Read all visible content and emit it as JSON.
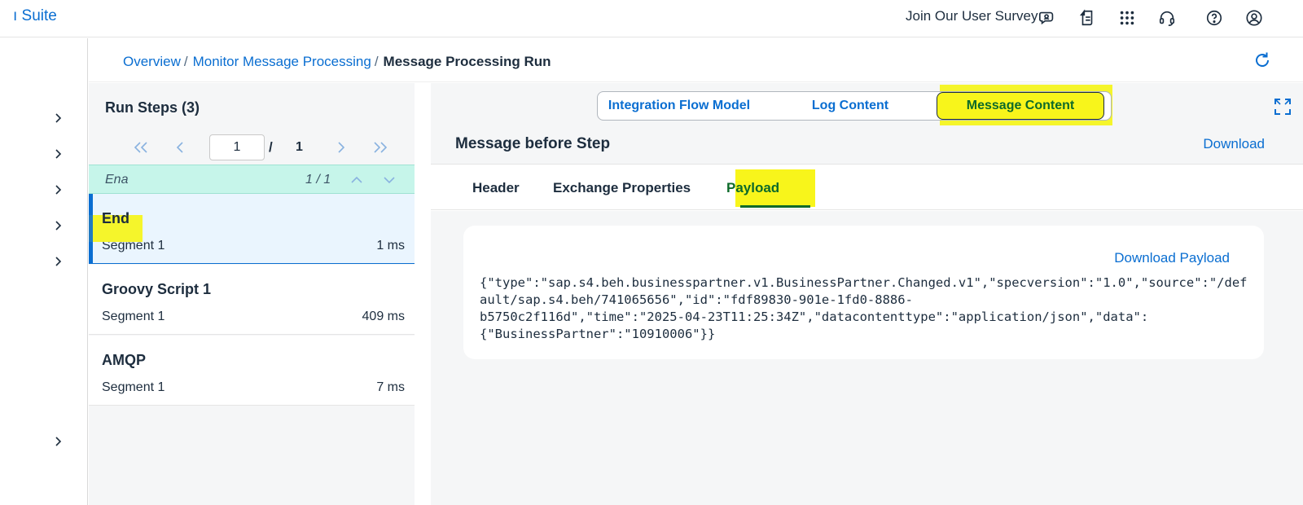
{
  "shell": {
    "title": "ı Suite",
    "survey": "Join Our User Survey",
    "icons": [
      "feedback-icon",
      "notes-icon",
      "apps-grid-icon",
      "headset-icon",
      "help-icon",
      "user-icon"
    ]
  },
  "breadcrumb": {
    "items": [
      "Overview",
      "Monitor Message Processing"
    ],
    "separator": "/",
    "current": "Message Processing Run"
  },
  "run_steps": {
    "title": "Run Steps (3)",
    "pager": {
      "current": "1",
      "slash": "/",
      "total": "1"
    },
    "search": {
      "term": "Ena",
      "count": "1 / 1"
    },
    "steps": [
      {
        "name": "End",
        "segment": "Segment 1",
        "duration": "1 ms",
        "selected": true
      },
      {
        "name": "Groovy Script 1",
        "segment": "Segment 1",
        "duration": "409 ms",
        "selected": false
      },
      {
        "name": "AMQP",
        "segment": "Segment 1",
        "duration": "7 ms",
        "selected": false
      }
    ]
  },
  "view_switch": {
    "options": [
      "Integration Flow Model",
      "Log Content",
      "Message Content"
    ],
    "selected": "Message Content"
  },
  "message": {
    "title": "Message before Step",
    "download": "Download",
    "tabs": [
      "Header",
      "Exchange Properties",
      "Payload"
    ],
    "active_tab": "Payload",
    "download_payload": "Download Payload",
    "payload": "{\"type\":\"sap.s4.beh.businesspartner.v1.BusinessPartner.Changed.v1\",\"specversion\":\"1.0\",\"source\":\"/default/sap.s4.beh/741065656\",\"id\":\"fdf89830-901e-1fd0-8886-\nb5750c2f116d\",\"time\":\"2025-04-23T11:25:34Z\",\"datacontenttype\":\"application/json\",\"data\":\n{\"BusinessPartner\":\"10910006\"}}"
  },
  "colors": {
    "link": "#0a6ed1",
    "text": "#1d2d3e",
    "highlight": "#f8f51b",
    "search_row": "#c6f5ea"
  }
}
